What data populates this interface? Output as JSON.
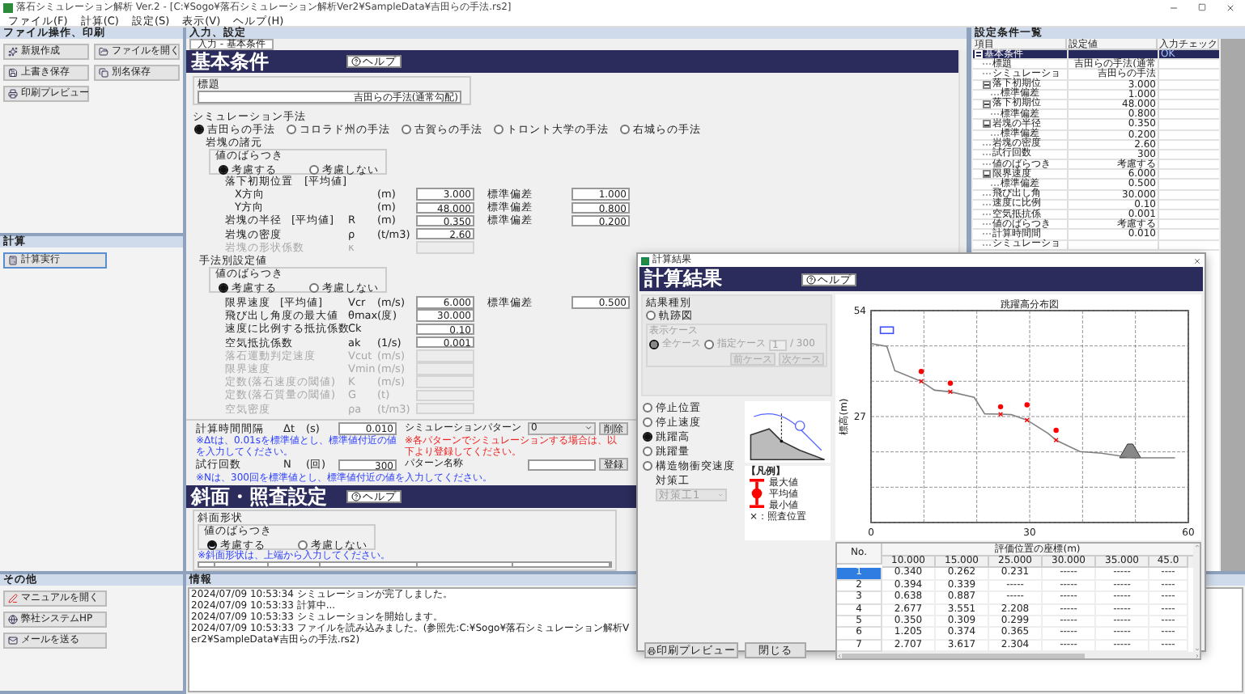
{
  "window": {
    "title": "落石シミュレーション解析 Ver.2 - [C:¥Sogo¥落石シミュレーション解析Ver2¥SampleData¥吉田らの手法.rs2]"
  },
  "menu": [
    "ファイル(F)",
    "計算(C)",
    "設定(S)",
    "表示(V)",
    "ヘルプ(H)"
  ],
  "left_panel": {
    "sections": [
      {
        "title": "ファイル操作、印刷",
        "kind": "grid",
        "buttons": [
          "新規作成",
          "ファイルを開く",
          "上書き保存",
          "別名保存",
          "印刷プレビュー"
        ]
      },
      {
        "title": "計算",
        "kind": "list",
        "buttons": [
          "計算実行"
        ]
      },
      {
        "title": "その他",
        "kind": "list",
        "buttons": [
          "マニュアルを開く",
          "弊社システムHP",
          "メールを送る"
        ]
      }
    ]
  },
  "input_panel": {
    "title": "入力、設定",
    "tab": "入力 - 基本条件",
    "basic": {
      "heading": "基本条件",
      "help": "ヘルプ",
      "title_label": "標題",
      "title_value": "吉田らの手法(通常勾配)",
      "method_label": "シミュレーション手法",
      "methods": [
        {
          "label": "吉田らの手法",
          "selected": true
        },
        {
          "label": "コロラド州の手法",
          "selected": false
        },
        {
          "label": "古賀らの手法",
          "selected": false
        },
        {
          "label": "トロント大学の手法",
          "selected": false
        },
        {
          "label": "右城らの手法",
          "selected": false
        }
      ],
      "rock": {
        "label": "岩塊の諸元",
        "variation_label": "値のばらつき",
        "variation": [
          {
            "label": "考慮する",
            "selected": true
          },
          {
            "label": "考慮しない",
            "selected": false
          }
        ],
        "subheading": "落下初期位置　[平均値]",
        "rows": [
          {
            "kind": "sub",
            "label": "X方向",
            "unit": "(m)",
            "value": "3.000",
            "sd_label": "標準偏差",
            "sd_value": "1.000",
            "disabled": false
          },
          {
            "kind": "sub",
            "label": "Y方向",
            "unit": "(m)",
            "value": "48.000",
            "sd_label": "標準偏差",
            "sd_value": "0.800",
            "disabled": false
          },
          {
            "kind": "main",
            "label": "岩塊の半径",
            "tag": "[平均値]",
            "symbol": "R",
            "unit": "(m)",
            "value": "0.350",
            "sd_label": "標準偏差",
            "sd_value": "0.200",
            "disabled": false
          },
          {
            "kind": "main",
            "label": "岩塊の密度",
            "symbol": "ρ",
            "unit": "(t/m3)",
            "value": "2.60",
            "disabled": false
          },
          {
            "kind": "main",
            "label": "岩塊の形状係数",
            "symbol": "κ",
            "disabled": true
          }
        ]
      },
      "params": {
        "label": "手法別設定値",
        "variation_label": "値のばらつき",
        "variation": [
          {
            "label": "考慮する",
            "selected": true
          },
          {
            "label": "考慮しない",
            "selected": false
          }
        ],
        "rows": [
          {
            "kind": "main",
            "label": "限界速度",
            "tag": "[平均値]",
            "symbol": "Vcr",
            "unit": "(m/s)",
            "value": "6.000",
            "sd_label": "標準偏差",
            "sd_value": "0.500",
            "disabled": false
          },
          {
            "kind": "main",
            "label": "飛び出し角度の最大値",
            "symbol": "θmax",
            "unit": "(度)",
            "value": "30.000",
            "disabled": false
          },
          {
            "kind": "main",
            "label": "速度に比例する抵抗係数",
            "symbol": "Ck",
            "value": "0.10",
            "disabled": false
          },
          {
            "kind": "main",
            "label": "空気抵抗係数",
            "symbol": "ak",
            "unit": "(1/s)",
            "value": "0.001",
            "disabled": false
          },
          {
            "kind": "main",
            "label": "落石運動判定速度",
            "symbol": "Vcut",
            "unit": "(m/s)",
            "disabled": true
          },
          {
            "kind": "main",
            "label": "限界速度",
            "symbol": "Vmin",
            "unit": "(m/s)",
            "disabled": true
          },
          {
            "kind": "main",
            "label": "定数(落石速度の閾値)",
            "symbol": "K",
            "unit": "(m/s)",
            "disabled": true
          },
          {
            "kind": "main",
            "label": "定数(落石質量の閾値)",
            "symbol": "G",
            "unit": "(t)",
            "disabled": true
          },
          {
            "kind": "main",
            "label": "空気密度",
            "symbol": "ρa",
            "unit": "(t/m3)",
            "disabled": true
          }
        ]
      },
      "dt": {
        "label": "計算時間間隔",
        "symbol": "Δt",
        "unit": "(s)",
        "value": "0.010",
        "note": "※Δtは、0.01sを標準値とし、標準値付近の値を入力してください。"
      },
      "n": {
        "label": "試行回数",
        "symbol": "N",
        "unit": "(回)",
        "value": "300",
        "note": "※Nは、300回を標準値とし、標準値付近の値を入力してください。"
      },
      "pattern": {
        "label": "シミュレーションパターン",
        "value": "0",
        "delete": "削除",
        "warning": "※各パターンでシミュレーションする場合は、以下より登録してください。",
        "name_label": "パターン名称",
        "register": "登録"
      }
    },
    "slope": {
      "heading": "斜面・照査設定",
      "help": "ヘルプ",
      "shape_label": "斜面形状",
      "variation_label": "値のばらつき",
      "variation": [
        {
          "label": "考慮する",
          "selected": true
        },
        {
          "label": "考慮しない",
          "selected": false
        }
      ],
      "note": "※斜面形状は、上端から入力してください。"
    }
  },
  "conditions": {
    "title": "設定条件一覧",
    "columns": [
      "項目",
      "設定値",
      "入力チェック"
    ],
    "tree": [
      {
        "name": "基本条件",
        "check": "OK",
        "selected": true,
        "expanded": true,
        "children": [
          {
            "name": "標題",
            "value": "吉田らの手法(通常",
            "selected": false
          },
          {
            "name": "シミュレーショ",
            "value": "吉田らの手法",
            "selected": false
          },
          {
            "name": "落下初期位",
            "value": "3.000",
            "selected": false,
            "expanded": true,
            "children": [
              {
                "name": "標準偏差",
                "value": "1.000",
                "selected": false
              }
            ]
          },
          {
            "name": "落下初期位",
            "value": "48.000",
            "selected": false,
            "expanded": true,
            "children": [
              {
                "name": "標準偏差",
                "value": "0.800",
                "selected": false
              }
            ]
          },
          {
            "name": "岩塊の半径",
            "value": "0.350",
            "selected": false,
            "expanded": true,
            "children": [
              {
                "name": "標準偏差",
                "value": "0.200",
                "selected": false
              }
            ]
          },
          {
            "name": "岩塊の密度",
            "value": "2.60",
            "selected": false
          },
          {
            "name": "試行回数",
            "value": "300",
            "selected": false
          },
          {
            "name": "値のばらつき",
            "value": "考慮する",
            "selected": false
          },
          {
            "name": "限界速度",
            "value": "6.000",
            "selected": false,
            "expanded": true,
            "children": [
              {
                "name": "標準偏差",
                "value": "0.500",
                "selected": false
              }
            ]
          },
          {
            "name": "飛び出し角",
            "value": "30.000",
            "selected": false
          },
          {
            "name": "速度に比例",
            "value": "0.10",
            "selected": false
          },
          {
            "name": "空気抵抗係",
            "value": "0.001",
            "selected": false
          },
          {
            "name": "値のばらつき",
            "value": "考慮する",
            "selected": false
          },
          {
            "name": "計算時間間",
            "value": "0.010",
            "selected": false
          },
          {
            "name": "シミュレーショ",
            "selected": false
          }
        ]
      }
    ]
  },
  "info": {
    "title": "情報",
    "lines": [
      "2024/07/09 10:53:34 シミュレーションが完了しました。",
      "2024/07/09 10:53:33 計算中...",
      "2024/07/09 10:53:33 シミュレーションを開始します。",
      "2024/07/09 10:53:33 ファイルを読み込みました。(参照先:C:¥Sogo¥落石シミュレーション解析Ver2¥SampleData¥吉田らの手法.rs2)"
    ]
  },
  "result_dialog": {
    "window_title": "計算結果",
    "heading": "計算結果",
    "help": "ヘルプ",
    "type_label": "結果種別",
    "trajectory": {
      "label": "軌跡図",
      "selected": false
    },
    "case_group": {
      "label": "表示ケース",
      "disabled": true,
      "options": [
        {
          "label": "全ケース",
          "selected": true
        },
        {
          "label": "指定ケース",
          "selected": false
        }
      ],
      "case_value": "1",
      "total": "/ 300",
      "prev": "前ケース",
      "next": "次ケース"
    },
    "results": [
      {
        "label": "停止位置",
        "selected": false
      },
      {
        "label": "停止速度",
        "selected": false
      },
      {
        "label": "跳躍高",
        "selected": true
      },
      {
        "label": "跳躍量",
        "selected": false
      },
      {
        "label": "構造物衝突速度",
        "selected": false
      }
    ],
    "countermeasure": {
      "label": "対策工",
      "value": "対策工1",
      "disabled": true
    },
    "legend": {
      "title": "【凡例】",
      "items": [
        "最大値",
        "平均値",
        "最小値"
      ],
      "check": "×：照査位置"
    },
    "chart_data": {
      "type": "line",
      "title": "跳躍高分布図",
      "ylabel": "標高(m)",
      "x": [
        0,
        3,
        4.5,
        9.5,
        12,
        15,
        19.5,
        21.5,
        24.5,
        26.5,
        29.5,
        33.5,
        35,
        39.5,
        43.5,
        49.5,
        57.5
      ],
      "xlim": [
        0,
        60
      ],
      "ylim": [
        0,
        54
      ],
      "xticks": [
        0,
        30,
        60
      ],
      "yticks": [
        27,
        54
      ],
      "series": [
        {
          "type": "line",
          "color": "#808080",
          "values": [
            45.6,
            44.9,
            38.7,
            36.0,
            33.7,
            33.3,
            31.9,
            27.7,
            27.6,
            27.5,
            26.1,
            22.7,
            21.0,
            18.1,
            17.7,
            16.5,
            16.5
          ]
        },
        {
          "type": "scatter",
          "color": "#ff0000",
          "values": [
            null,
            null,
            null,
            38.5,
            null,
            35.5,
            null,
            null,
            29.5,
            null,
            30.0,
            null,
            23.5,
            null,
            null,
            null,
            null
          ]
        }
      ]
    },
    "table": {
      "no_label": "No.",
      "group_label": "評価位置の座標(m)",
      "columns": [
        "10.000",
        "15.000",
        "25.000",
        "30.000",
        "35.000",
        "45.0"
      ],
      "rows": [
        {
          "no": "1",
          "selected": true,
          "cells": [
            "0.340",
            "0.262",
            "0.231",
            "-----",
            "-----",
            "----"
          ]
        },
        {
          "no": "2",
          "selected": false,
          "cells": [
            "0.394",
            "0.339",
            "-----",
            "-----",
            "-----",
            "----"
          ]
        },
        {
          "no": "3",
          "selected": false,
          "cells": [
            "0.638",
            "0.887",
            "-----",
            "-----",
            "-----",
            "----"
          ]
        },
        {
          "no": "4",
          "selected": false,
          "cells": [
            "2.677",
            "3.551",
            "2.208",
            "-----",
            "-----",
            "----"
          ]
        },
        {
          "no": "5",
          "selected": false,
          "cells": [
            "0.350",
            "0.309",
            "0.299",
            "-----",
            "-----",
            "----"
          ]
        },
        {
          "no": "6",
          "selected": false,
          "cells": [
            "1.205",
            "0.374",
            "0.365",
            "-----",
            "-----",
            "----"
          ]
        },
        {
          "no": "7",
          "selected": false,
          "cells": [
            "2.707",
            "3.617",
            "2.304",
            "-----",
            "-----",
            "----"
          ]
        }
      ]
    },
    "buttons": [
      "印刷プレビュー",
      "閉じる"
    ]
  }
}
